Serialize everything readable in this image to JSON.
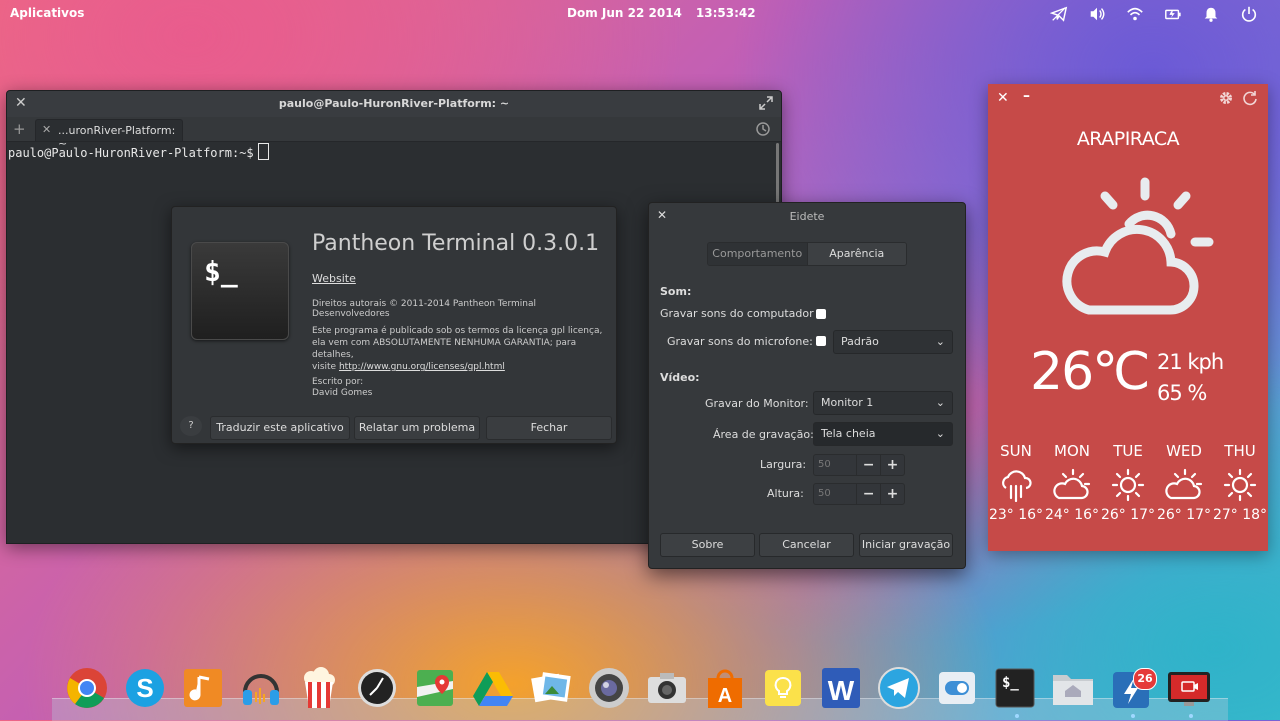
{
  "panel": {
    "apps_label": "Aplicativos",
    "date": "Dom Jun 22 2014",
    "time": "13:53:42"
  },
  "terminal": {
    "title": "paulo@Paulo-HuronRiver-Platform: ~",
    "tab_label": "...uronRiver-Platform: ~",
    "prompt": "paulo@Paulo-HuronRiver-Platform:~$"
  },
  "about": {
    "title": "Pantheon Terminal 0.3.0.1",
    "website": "Website",
    "copyright": "Direitos autorais © 2011-2014 Pantheon Terminal Desenvolvedores",
    "license_line1": "Este programa é publicado sob os termos da licença gpl licença,",
    "license_line2": "ela vem com ABSOLUTAMENTE NENHUMA GARANTIA; para detalhes,",
    "license_prefix": "visite",
    "license_link": "http://www.gnu.org/licenses/gpl.html",
    "authors_label": "Escrito por:",
    "authors_first": "David Gomes",
    "help": "?",
    "translate": "Traduzir este aplicativo",
    "report": "Relatar um problema",
    "close": "Fechar"
  },
  "eidete": {
    "title": "Eidete",
    "tab_behavior": "Comportamento",
    "tab_appearance": "Aparência",
    "sound_section": "Som:",
    "record_computer": "Gravar sons do computador",
    "record_mic": "Gravar sons do microfone:",
    "mic_device": "Padrão",
    "video_section": "Vídeo:",
    "monitor_label": "Gravar do Monitor:",
    "monitor_value": "Monitor 1",
    "area_label": "Área de gravação:",
    "area_value": "Tela cheia",
    "width_label": "Largura:",
    "width_value": "50",
    "height_label": "Altura:",
    "height_value": "50",
    "about_btn": "Sobre",
    "cancel_btn": "Cancelar",
    "start_btn": "Iniciar gravação"
  },
  "weather": {
    "city": "ARAPIRACA",
    "temp": "26℃",
    "wind": "21 kph",
    "humidity": "65 %",
    "forecast": [
      {
        "day": "SUN",
        "temps": "23° 16°",
        "icon": "rain-icon"
      },
      {
        "day": "MON",
        "temps": "24° 16°",
        "icon": "partly-cloudy-icon"
      },
      {
        "day": "TUE",
        "temps": "26° 17°",
        "icon": "sun-icon"
      },
      {
        "day": "WED",
        "temps": "26° 17°",
        "icon": "partly-cloudy-icon"
      },
      {
        "day": "THU",
        "temps": "27° 18°",
        "icon": "sun-icon"
      }
    ],
    "bg_color": "#c64a48"
  },
  "dock": {
    "badge_count": "26",
    "apps": [
      "chrome-icon",
      "skype-icon",
      "music-icon",
      "audio-recorder-icon",
      "popcorn-time-icon",
      "clock-icon",
      "maps-icon",
      "drive-icon",
      "photos-icon",
      "camera-icon",
      "screenshot-icon",
      "app-store-icon",
      "notes-icon",
      "wps-writer-icon",
      "telegram-icon",
      "switch-icon",
      "terminal-icon",
      "home-folder-icon",
      "dropbox-icon",
      "eidete-icon"
    ]
  }
}
